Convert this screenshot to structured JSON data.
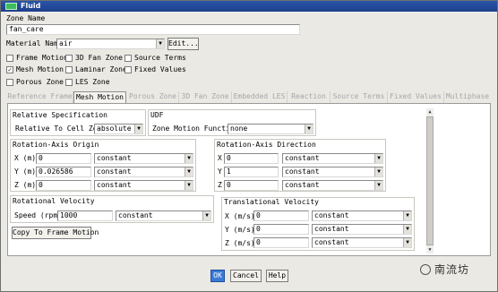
{
  "window": {
    "title": "Fluid"
  },
  "zone": {
    "label": "Zone Name",
    "value": "fan_care"
  },
  "material": {
    "label": "Material Name",
    "value": "air",
    "edit_label": "Edit..."
  },
  "options": [
    {
      "label": "Frame Motion",
      "checked": false
    },
    {
      "label": "3D Fan Zone",
      "checked": false
    },
    {
      "label": "Source Terms",
      "checked": false
    },
    {
      "label": "Mesh Motion",
      "checked": true
    },
    {
      "label": "Laminar Zone",
      "checked": false
    },
    {
      "label": "Fixed Values",
      "checked": false
    },
    {
      "label": "Porous Zone",
      "checked": false
    },
    {
      "label": "LES Zone",
      "checked": false
    }
  ],
  "tabs": [
    {
      "label": "Reference Frame",
      "active": false
    },
    {
      "label": "Mesh Motion",
      "active": true
    },
    {
      "label": "Porous Zone",
      "active": false
    },
    {
      "label": "3D Fan Zone",
      "active": false
    },
    {
      "label": "Embedded LES",
      "active": false
    },
    {
      "label": "Reaction",
      "active": false
    },
    {
      "label": "Source Terms",
      "active": false
    },
    {
      "label": "Fixed Values",
      "active": false
    },
    {
      "label": "Multiphase",
      "active": false
    }
  ],
  "relative_spec": {
    "title": "Relative Specification",
    "label": "Relative To Cell Zone",
    "value": "absolute"
  },
  "udf": {
    "title": "UDF",
    "label": "Zone Motion Function",
    "value": "none"
  },
  "rotation_origin": {
    "title": "Rotation-Axis Origin",
    "rows": [
      {
        "label": "X (m)",
        "value": "0",
        "method": "constant"
      },
      {
        "label": "Y (m)",
        "value": "0.026586",
        "method": "constant"
      },
      {
        "label": "Z (m)",
        "value": "0",
        "method": "constant"
      }
    ]
  },
  "rotation_direction": {
    "title": "Rotation-Axis Direction",
    "rows": [
      {
        "label": "X",
        "value": "0",
        "method": "constant"
      },
      {
        "label": "Y",
        "value": "1",
        "method": "constant"
      },
      {
        "label": "Z",
        "value": "0",
        "method": "constant"
      }
    ]
  },
  "rotational_velocity": {
    "title": "Rotational Velocity",
    "label": "Speed (rpm)",
    "value": "1000",
    "method": "constant",
    "copy_label": "Copy To Frame Motion"
  },
  "translational_velocity": {
    "title": "Translational Velocity",
    "rows": [
      {
        "label": "X (m/s)",
        "value": "0",
        "method": "constant"
      },
      {
        "label": "Y (m/s)",
        "value": "0",
        "method": "constant"
      },
      {
        "label": "Z (m/s)",
        "value": "0",
        "method": "constant"
      }
    ]
  },
  "footer": {
    "ok_label": "OK",
    "cancel_label": "Cancel",
    "help_label": "Help"
  },
  "watermark": {
    "text": "南流坊"
  },
  "colors": {
    "titlebar": "#1c3f8b",
    "ok_button": "#3a7bd5"
  }
}
